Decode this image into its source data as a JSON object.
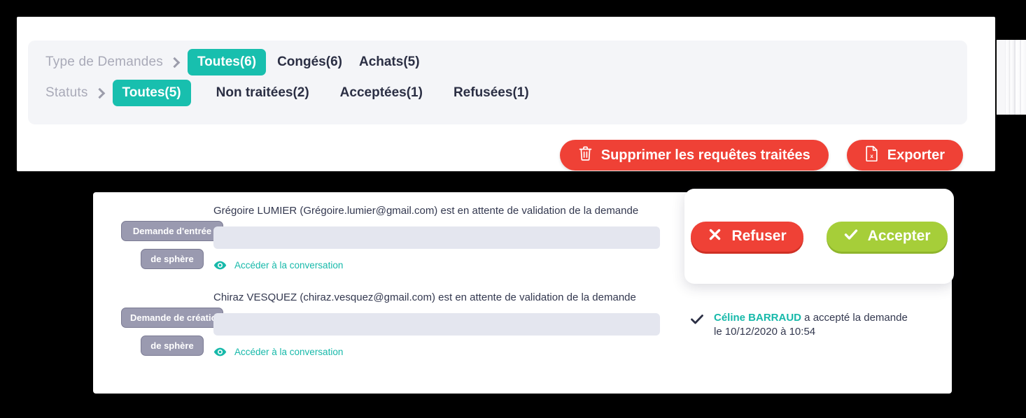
{
  "filters": {
    "type_row": {
      "label": "Type de Demandes",
      "separator_icon": "chevron-right-icon",
      "items": [
        {
          "label": "Toutes(6)",
          "active": true
        },
        {
          "label": "Congés(6)",
          "active": false
        },
        {
          "label": "Achats(5)",
          "active": false
        }
      ]
    },
    "status_row": {
      "label": "Statuts",
      "separator_icon": "chevron-right-icon",
      "items": [
        {
          "label": "Toutes(5)",
          "active": true
        },
        {
          "label": "Non traitées(2)",
          "active": false
        },
        {
          "label": "Acceptées(1)",
          "active": false
        },
        {
          "label": "Refusées(1)",
          "active": false
        }
      ]
    }
  },
  "toolbar": {
    "delete_label": "Supprimer les requêtes traitées",
    "delete_icon": "trash-icon",
    "export_label": "Exporter",
    "export_icon": "excel-file-icon"
  },
  "requests": [
    {
      "tag_main": "Demande d'entrée",
      "tag_sub": "de sphère",
      "title": "Grégoire LUMIER (Grégoire.lumier@gmail.com) est en attente de validation de la demande",
      "conversation_link": "Accéder à la conversation",
      "conversation_icon": "eye-icon"
    },
    {
      "tag_main": "Demande de création",
      "tag_sub": "de sphère",
      "title": "Chiraz VESQUEZ (chiraz.vesquez@gmail.com) est en attente de validation de la demande",
      "conversation_link": "Accéder à la conversation",
      "conversation_icon": "eye-icon"
    }
  ],
  "decision_panel": {
    "refuse_label": "Refuser",
    "refuse_icon": "cross-icon",
    "accept_label": "Accepter",
    "accept_icon": "check-icon"
  },
  "status_message": {
    "icon": "check-icon",
    "actor": "Céline BARRAUD",
    "action": " a accepté la demande",
    "datetime": "le 10/12/2020 à 10:54"
  },
  "colors": {
    "teal": "#18bfae",
    "red": "#ef4136",
    "green": "#a6ce39",
    "tag_gray": "#9a9ab0",
    "dark_text": "#33384f",
    "muted_label": "#a9aab8"
  }
}
